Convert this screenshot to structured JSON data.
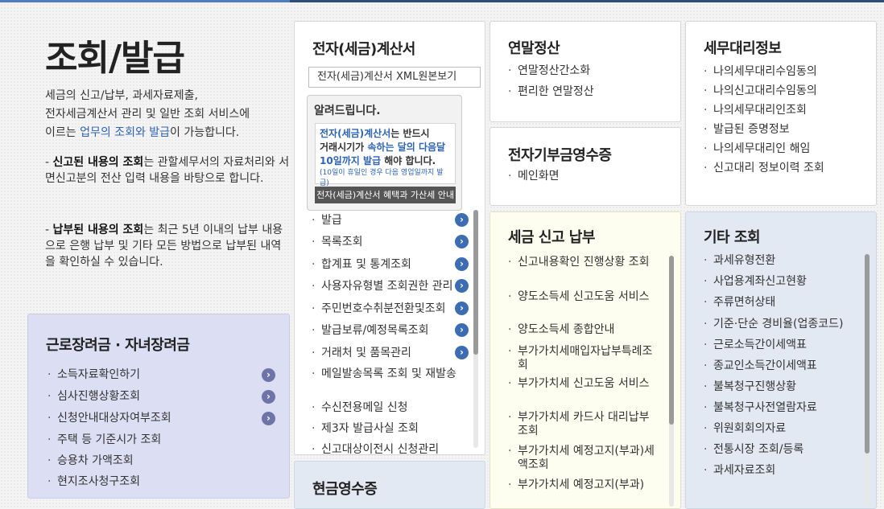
{
  "intro": {
    "title": "조회/발급",
    "desc_line1": "세금의 신고/납부, 과세자료제출,",
    "desc_line2": "전자세금계산서 관리 및 일반 조회 서비스에",
    "desc_line3_pre": "이르는 ",
    "desc_line3_hl": "업무의 조회와 발급",
    "desc_line3_post": "이 가능합니다.",
    "note1_bold": "신고된 내용의 조회",
    "note1_text": "는 관할세무서의 자료처리와 서면신고분의 전산 입력 내용을 바탕으로 합니다.",
    "note2_bold": "납부된 내용의 조회",
    "note2_text": "는 최근 5년 이내의 납부 내용으로 은행 납부 및 기타 모든 방법으로 납부된 내역을 확인하실 수 있습니다."
  },
  "einvoice": {
    "title": "전자(세금)계산서",
    "xml_select": "전자(세금)계산서 XML원본보기",
    "notice_title": "알려드립니다.",
    "notice_l1a": "전자(세금)계산서",
    "notice_l1b": "는 반드시",
    "notice_l2a": "거래시기가 ",
    "notice_l2b": "속하는 달의 다음달",
    "notice_l3a": "10일까지 발급",
    "notice_l3b": " 해야 합니다.",
    "notice_small": "(10일이 휴일인 경우 다음 영업일까지 발급)",
    "notice_button": "전자(세금)계산서 혜택과 가산세 안내",
    "items": [
      "발급",
      "목록조회",
      "합계표 및 통계조회",
      "사용자유형별 조회권한 관리",
      "주민번호수취분전환및조회",
      "발급보류/예정목록조회",
      "거래처 및 품목관리",
      "메일발송목록 조회 및 재발송",
      "수신전용메일 신청",
      "제3자 발급사실 조회",
      "신고대상이전시 신청관리"
    ]
  },
  "year_end": {
    "title": "연말정산",
    "items": [
      "연말정산간소화",
      "편리한 연말정산"
    ]
  },
  "donation": {
    "title": "전자기부금영수증",
    "items": [
      "메인화면"
    ]
  },
  "agent": {
    "title": "세무대리정보",
    "items": [
      "나의세무대리수임동의",
      "나의신고대리수임동의",
      "나의세무대리인조회",
      "발급된 증명정보",
      "나의세무대리인 해임",
      "신고대리 정보이력 조회"
    ]
  },
  "earned": {
    "title": "근로장려금 · 자녀장려금",
    "items": [
      "소득자료확인하기",
      "심사진행상황조회",
      "신청안내대상자여부조회",
      "주택 등 기준시가 조회",
      "승용차 가액조회",
      "현지조사청구조회"
    ]
  },
  "tax_report": {
    "title": "세금 신고 납부",
    "items": [
      "신고내용확인 진행상황 조회",
      "양도소득세 신고도움 서비스",
      "양도소득세 종합안내",
      "부가가치세매입자납부특례조회",
      "부가가치세 신고도움 서비스",
      "부가가치세 카드사 대리납부 조회",
      "부가가치세 예정고지(부과)세액조회",
      "부가가치세 예정고지(부과)"
    ]
  },
  "other": {
    "title": "기타 조회",
    "items": [
      "과세유형전환",
      "사업용계좌신고현황",
      "주류면허상태",
      "기준·단순 경비율(업종코드)",
      "근로소득간이세액표",
      "종교인소득간이세액표",
      "불복청구진행상황",
      "불복청구사전열람자료",
      "위원회회의자료",
      "전통시장 조회/등록",
      "과세자료조회"
    ]
  },
  "cash_receipt": {
    "title": "현금영수증"
  },
  "colors": {
    "accent_blue": "#2d63b5",
    "arrow_blue": "#3c6db4",
    "top_bar": "#2b4d7a"
  }
}
